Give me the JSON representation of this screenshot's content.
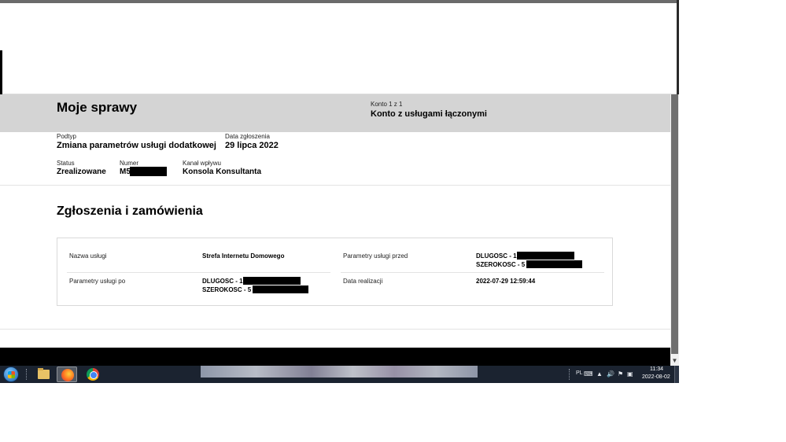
{
  "header": {
    "title": "Moje sprawy",
    "account_counter": "Konto 1 z 1",
    "account_name": "Konto z usługami łączonymi"
  },
  "case": {
    "subtype_label": "Podtyp",
    "subtype_value": "Zmiana parametrów usługi dodatkowej",
    "date_label": "Data zgłoszenia",
    "date_value": "29 lipca 2022",
    "status_label": "Status",
    "status_value": "Zrealizowane",
    "number_label": "Numer",
    "number_value": "M5",
    "channel_label": "Kanał wpływu",
    "channel_value": "Konsola Konsultanta"
  },
  "orders": {
    "title": "Zgłoszenia i zamówienia",
    "service_name_label": "Nazwa usługi",
    "service_name_value": "Strefa Internetu Domowego",
    "params_before_label": "Parametry usługi przed",
    "params_before_line1": "DLUGOSC - 1",
    "params_before_line2": "SZEROKOSC - 5",
    "params_after_label": "Parametry usługi po",
    "params_after_line1": "DLUGOSC - 1",
    "params_after_line2": "SZEROKOSC - 5",
    "realization_label": "Data realizacji",
    "realization_value": "2022-07-29 12:59:44"
  },
  "taskbar": {
    "language": "PL",
    "time": "11:34",
    "date": "2022-08-02"
  },
  "icons": [
    "windows-start-icon",
    "file-explorer-icon",
    "firefox-icon",
    "chrome-icon",
    "keyboard-icon",
    "volume-icon",
    "flag-icon",
    "network-icon"
  ]
}
